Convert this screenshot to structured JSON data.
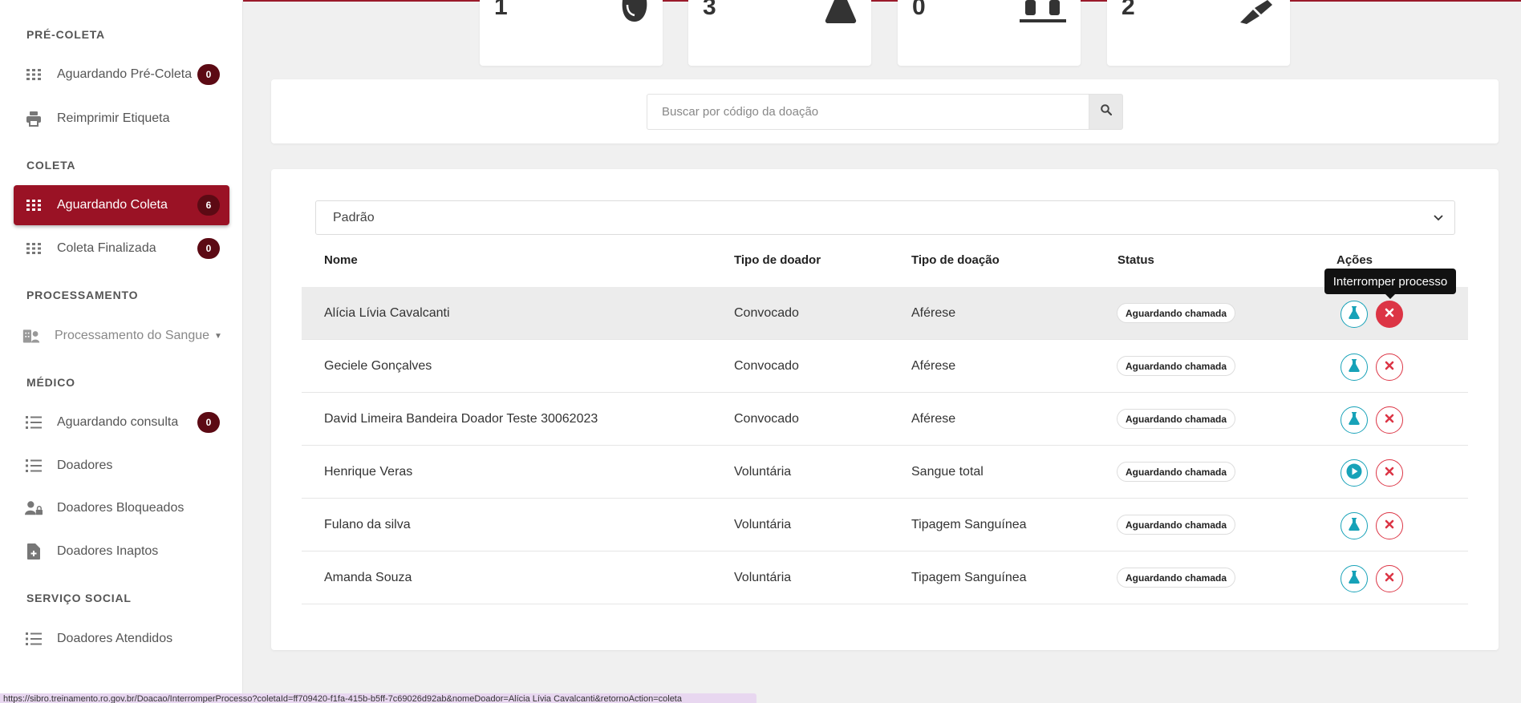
{
  "sidebar": {
    "sections": {
      "pre_coleta": "PRÉ-COLETA",
      "coleta": "COLETA",
      "processamento": "PROCESSAMENTO",
      "medico": "MÉDICO",
      "servico_social": "SERVIÇO SOCIAL"
    },
    "items": [
      {
        "label": "Aguardando Pré-Coleta",
        "count": "0",
        "icon": "grid-icon"
      },
      {
        "label": "Reimprimir Etiqueta",
        "icon": "printer-icon"
      },
      {
        "label": "Aguardando Coleta",
        "count": "6",
        "icon": "grid-icon",
        "active": true
      },
      {
        "label": "Coleta Finalizada",
        "count": "0",
        "icon": "grid-icon"
      },
      {
        "label": "Processamento do Sangue",
        "icon": "hospital-user-icon"
      },
      {
        "label": "Aguardando consulta",
        "count": "0",
        "icon": "list-icon"
      },
      {
        "label": "Doadores",
        "icon": "list-icon"
      },
      {
        "label": "Doadores Bloqueados",
        "icon": "user-lock-icon"
      },
      {
        "label": "Doadores Inaptos",
        "icon": "file-medical-icon"
      },
      {
        "label": "Doadores Atendidos",
        "icon": "list-icon"
      }
    ]
  },
  "stats": [
    {
      "value": "1",
      "icon": "blood-drop-icon"
    },
    {
      "value": "3",
      "icon": "flask-icon"
    },
    {
      "value": "0",
      "icon": "vials-icon"
    },
    {
      "value": "2",
      "icon": "syringe-icon"
    }
  ],
  "search": {
    "placeholder": "Buscar por código da doação",
    "value": ""
  },
  "filter": {
    "selected": "Padrão"
  },
  "table": {
    "headers": {
      "nome": "Nome",
      "tipo_doador": "Tipo de doador",
      "tipo_doacao": "Tipo de doação",
      "status": "Status",
      "acoes": "Ações"
    },
    "rows": [
      {
        "nome": "Alícia Lívia Cavalcanti",
        "tipo_doador": "Convocado",
        "tipo_doacao": "Aférese",
        "status": "Aguardando chamada",
        "action": "flask-icon"
      },
      {
        "nome": "Geciele Gonçalves",
        "tipo_doador": "Convocado",
        "tipo_doacao": "Aférese",
        "status": "Aguardando chamada",
        "action": "flask-icon"
      },
      {
        "nome": "David Limeira Bandeira Doador Teste 30062023",
        "tipo_doador": "Convocado",
        "tipo_doacao": "Aférese",
        "status": "Aguardando chamada",
        "action": "flask-icon"
      },
      {
        "nome": "Henrique Veras",
        "tipo_doador": "Voluntária",
        "tipo_doacao": "Sangue total",
        "status": "Aguardando chamada",
        "action": "play-icon"
      },
      {
        "nome": "Fulano da silva",
        "tipo_doador": "Voluntária",
        "tipo_doacao": "Tipagem Sanguínea",
        "status": "Aguardando chamada",
        "action": "flask-icon"
      },
      {
        "nome": "Amanda Souza",
        "tipo_doador": "Voluntária",
        "tipo_doacao": "Tipagem Sanguínea",
        "status": "Aguardando chamada",
        "action": "flask-icon"
      }
    ]
  },
  "tooltip": "Interromper processo",
  "status_url": "https://sibro.treinamento.ro.gov.br/Doacao/InterromperProcesso?coletaId=ff709420-f1fa-415b-b5ff-7c69026d92ab&nomeDoador=Alícia Lívia Cavalcanti&retornoAction=coleta",
  "colors": {
    "accent": "#9a1225",
    "badge": "#5c0a14",
    "teal": "#17a2b8",
    "danger": "#dc3545"
  }
}
